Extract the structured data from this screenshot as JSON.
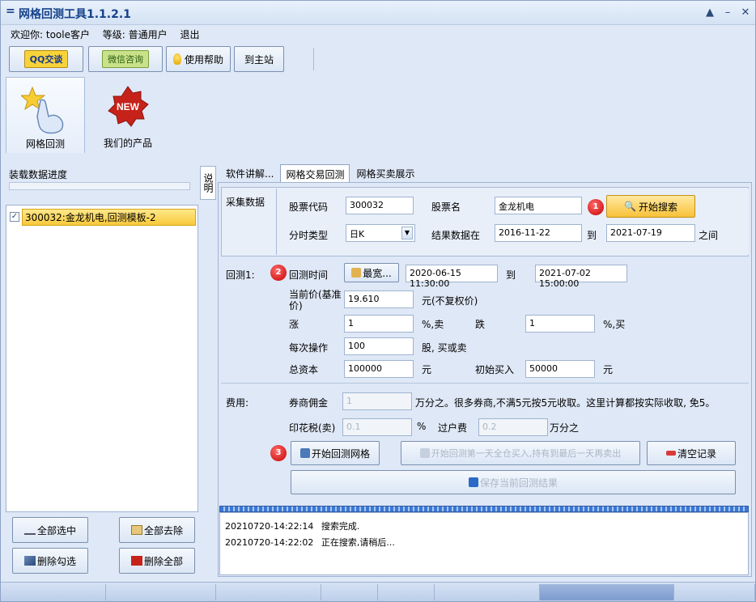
{
  "window": {
    "title": "网格回测工具1.1.2.1",
    "menu_glyph": "=",
    "btn_min": "▲",
    "btn_max": "–",
    "btn_close": "✕"
  },
  "welcome": {
    "greeting": "欢迎你: toole客户",
    "level": "等级: 普通用户",
    "logout": "退出"
  },
  "toolbar": {
    "qq_label": "QQ交谈",
    "wx_label": "微信咨询",
    "help_label": "使用帮助",
    "site_label": "到主站"
  },
  "nav": {
    "grid_label": "网格回测",
    "products_label": "我们的产品",
    "new_badge": "NEW"
  },
  "left": {
    "progress_label": "装载数据进度",
    "list_items": [
      "300032:金龙机电,回测模板-2"
    ],
    "select_all": "全部选中",
    "deselect_all": "全部去除",
    "delete_checked": "删除勾选",
    "delete_all": "删除全部"
  },
  "vtab_label": "说明",
  "tabs": [
    "软件讲解...",
    "网格交易回测",
    "网格买卖展示"
  ],
  "collect": {
    "group_label": "采集数据",
    "code_label": "股票代码",
    "code_value": "300032",
    "name_label": "股票名",
    "name_value": "金龙机电",
    "search_button": "开始搜索",
    "period_label": "分时类型",
    "period_value": "日K",
    "range_label": "结果数据在",
    "range_start": "2016-11-22",
    "to_label": "到",
    "range_end": "2021-07-19",
    "between_label": "之间"
  },
  "backtest": {
    "group_label": "回测1:",
    "time_label": "回测时间",
    "widest_button": "最宽...",
    "start_time": "2020-06-15 11:30:00",
    "to_label": "到",
    "end_time": "2021-07-02 15:00:00",
    "price_label": "当前价(基准价)",
    "price_value": "19.610",
    "price_unit": "元(不复权价)",
    "rise_label": "涨",
    "rise_value": "1",
    "rise_unit": "%,卖",
    "fall_label": "跌",
    "fall_value": "1",
    "fall_unit": "%,买",
    "per_op_label": "每次操作",
    "per_op_value": "100",
    "per_op_unit": "股, 买或卖",
    "capital_label": "总资本",
    "capital_value": "100000",
    "capital_unit": "元",
    "initial_label": "初始买入",
    "initial_value": "50000",
    "initial_unit": "元"
  },
  "fees": {
    "group_label": "费用:",
    "commission_label": "券商佣金",
    "commission_value": "1",
    "commission_note": "万分之。很多券商,不满5元按5元收取。这里计算都按实际收取, 免5。",
    "stamp_label": "印花税(卖)",
    "stamp_value": "0.1",
    "stamp_unit": "%",
    "transfer_label": "过户费",
    "transfer_value": "0.2",
    "transfer_unit": "万分之"
  },
  "actions": {
    "start_button": "开始回测网格",
    "disabled_button": "开始回测第一天全仓买入,持有到最后一天再卖出",
    "clear_button": "清空记录",
    "save_button": "保存当前回测结果"
  },
  "steps": [
    "1",
    "2",
    "3"
  ],
  "log": [
    {
      "time": "20210720-14:22:14",
      "text": "搜索完成."
    },
    {
      "time": "20210720-14:22:02",
      "text": "正在搜索,请稍后..."
    }
  ]
}
